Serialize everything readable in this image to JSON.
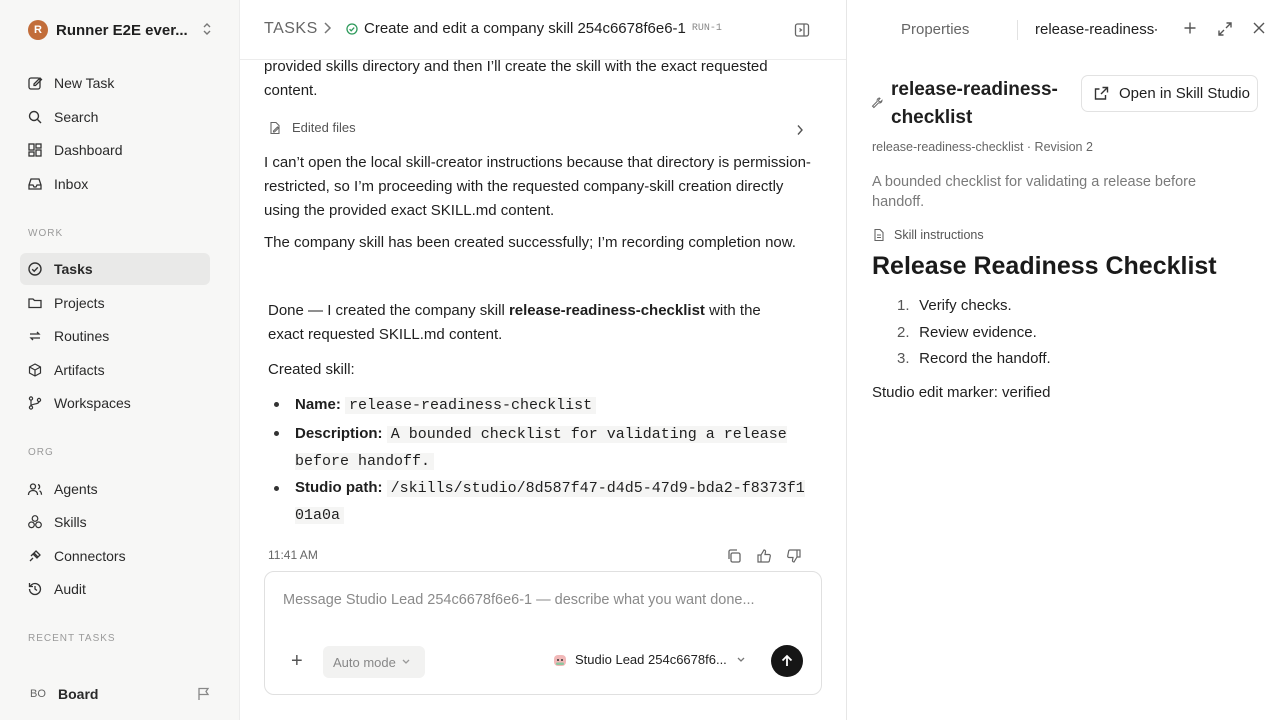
{
  "workspace": {
    "logo_letter": "R",
    "name": "Runner E2E ever..."
  },
  "nav": {
    "new_task": "New Task",
    "search": "Search",
    "dashboard": "Dashboard",
    "inbox": "Inbox",
    "work_label": "WORK",
    "tasks": "Tasks",
    "projects": "Projects",
    "routines": "Routines",
    "artifacts": "Artifacts",
    "workspaces": "Workspaces",
    "org_label": "ORG",
    "agents": "Agents",
    "skills": "Skills",
    "connectors": "Connectors",
    "audit": "Audit",
    "recent_label": "RECENT TASKS",
    "board_initials": "BO",
    "board": "Board"
  },
  "breadcrumb": {
    "root": "TASKS",
    "title": "Create and edit a company skill 254c6678f6e6-1",
    "run": "RUN-1"
  },
  "thread": {
    "p0": "provided skills directory and then I’ll create the skill with the exact requested content.",
    "edited_files": "Edited files",
    "p1": "I can’t open the local skill-creator instructions because that directory is permission-restricted, so I’m proceeding with the requested company-skill creation directly using the provided exact SKILL.md content.",
    "p2": "The company skill has been created successfully; I’m recording completion now.",
    "final_pre": "Done — I created the company skill ",
    "final_bold": "release-readiness-checklist",
    "final_post": " with the exact requested SKILL.md content.",
    "created": "Created skill:",
    "items": [
      {
        "label": "Name:",
        "value": "release-readiness-checklist"
      },
      {
        "label": "Description:",
        "value": "A bounded checklist for validating a release before handoff."
      },
      {
        "label": "Studio path:",
        "value": "/skills/studio/8d587f47-d4d5-47d9-bda2-f8373f101a0a"
      }
    ],
    "time": "11:41 AM"
  },
  "composer": {
    "placeholder": "Message Studio Lead 254c6678f6e6-1 — describe what you want done...",
    "mode": "Auto mode",
    "agent": "Studio Lead 254c6678f6..."
  },
  "panel": {
    "tab_properties": "Properties",
    "tab_skill": "release-readiness-checklist",
    "title": "release-readiness-checklist",
    "open_button": "Open in Skill Studio",
    "meta": "release-readiness-checklist · Revision 2",
    "description": "A bounded checklist for validating a release before handoff.",
    "instructions_label": "Skill instructions",
    "doc_heading": "Release Readiness Checklist",
    "steps": [
      "Verify checks.",
      "Review evidence.",
      "Record the handoff."
    ],
    "step_numbers": [
      "1.",
      "2.",
      "3."
    ],
    "marker": "Studio edit marker: verified"
  }
}
